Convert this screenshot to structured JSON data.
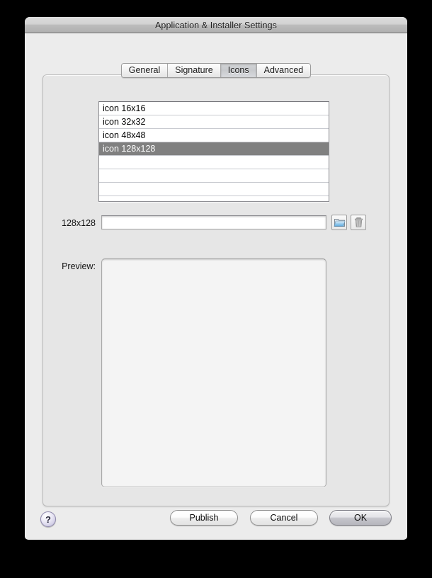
{
  "window": {
    "title": "Application & Installer Settings"
  },
  "tabs": [
    {
      "label": "General",
      "selected": false
    },
    {
      "label": "Signature",
      "selected": false
    },
    {
      "label": "Icons",
      "selected": true
    },
    {
      "label": "Advanced",
      "selected": false
    }
  ],
  "icon_list": {
    "items": [
      {
        "label": "icon 16x16",
        "selected": false
      },
      {
        "label": "icon 32x32",
        "selected": false
      },
      {
        "label": "icon 48x48",
        "selected": false
      },
      {
        "label": "icon 128x128",
        "selected": true
      },
      {
        "label": "",
        "selected": false
      },
      {
        "label": "",
        "selected": false
      },
      {
        "label": "",
        "selected": false
      },
      {
        "label": "",
        "selected": false
      }
    ],
    "selection_color": "#808080"
  },
  "field_row": {
    "size_label": "128x128",
    "path_value": "",
    "path_placeholder": "",
    "choose_icon": "folder-icon",
    "delete_icon": "trash-icon"
  },
  "preview": {
    "label": "Preview:"
  },
  "bottom_bar": {
    "help_label": "?",
    "publish_label": "Publish",
    "cancel_label": "Cancel",
    "ok_label": "OK"
  },
  "colors": {
    "window_bg": "#ececec",
    "panel_bg": "#e6e6e6",
    "titlebar_top": "#dedede",
    "titlebar_bottom": "#b0b0b0",
    "folder_blue": "#5aa9e6"
  }
}
